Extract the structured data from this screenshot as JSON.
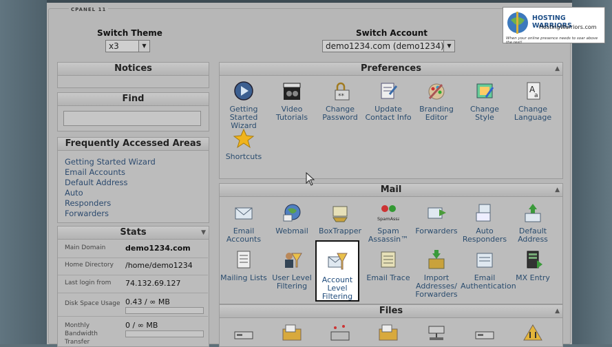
{
  "brand": "CPANEL 11",
  "logo": {
    "title": "HOSTING WARRIORS",
    "url_text": "HostingWarriors.com",
    "tagline": "When your online presence needs to soar above the rest!"
  },
  "switch_theme": {
    "label": "Switch Theme",
    "value": "x3"
  },
  "switch_account": {
    "label": "Switch Account",
    "value": "demo1234.com (demo1234)"
  },
  "notices": {
    "title": "Notices"
  },
  "find": {
    "title": "Find",
    "placeholder": ""
  },
  "frequent": {
    "title": "Frequently Accessed Areas",
    "links": [
      "Getting Started Wizard",
      "Email Accounts",
      "Default Address",
      "Auto",
      "Responders",
      "Forwarders"
    ]
  },
  "stats": {
    "title": "Stats",
    "rows": [
      {
        "label": "Main Domain",
        "value": "demo1234.com"
      },
      {
        "label": "Home Directory",
        "value": "/home/demo1234"
      },
      {
        "label": "Last login from",
        "value": "74.132.69.127"
      },
      {
        "label": "Disk Space Usage",
        "value": "0.43 / ∞ MB"
      },
      {
        "label": "Monthly Bandwidth Transfer",
        "value": "0 / ∞ MB"
      }
    ],
    "disk_fraction": 0.0,
    "bandwidth_fraction": 0.0
  },
  "preferences": {
    "title": "Preferences",
    "items": [
      "Getting Started Wizard",
      "Video Tutorials",
      "Change Password",
      "Update Contact Info",
      "Branding Editor",
      "Change Style",
      "Change Language",
      "Shortcuts"
    ]
  },
  "mail": {
    "title": "Mail",
    "items": [
      "Email Accounts",
      "Webmail",
      "BoxTrapper",
      "Spam Assassin™",
      "Forwarders",
      "Auto Responders",
      "Default Address",
      "Mailing Lists",
      "User Level Filtering",
      "Account Level Filtering",
      "Email Trace",
      "Import Addresses/ Forwarders",
      "Email Authentication",
      "MX Entry"
    ],
    "spam_logo_text": "SpamAssassin"
  },
  "files": {
    "title": "Files"
  },
  "colors": {
    "link": "#2c4a6e",
    "panel": "#b7b7b7",
    "highlight_bg": "#ffffff"
  }
}
